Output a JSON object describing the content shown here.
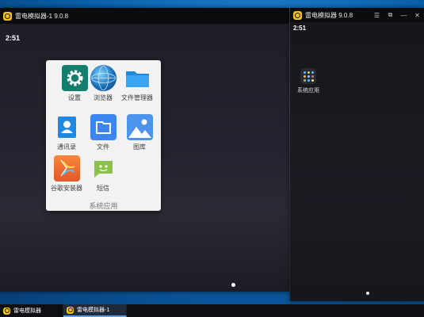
{
  "window_main": {
    "title": "雷电模拟器-1 9.0.8",
    "clock": "2:51",
    "folder": {
      "label": "系统应用",
      "apps": [
        {
          "label": "设置",
          "icon": "settings-icon"
        },
        {
          "label": "浏览器",
          "icon": "browser-globe-icon"
        },
        {
          "label": "文件管理器",
          "icon": "file-manager-folder-icon"
        },
        {
          "label": "通讯录",
          "icon": "contacts-icon"
        },
        {
          "label": "文件",
          "icon": "files-icon"
        },
        {
          "label": "图库",
          "icon": "gallery-icon"
        },
        {
          "label": "谷歌安装器",
          "icon": "google-installer-icon"
        },
        {
          "label": "短信",
          "icon": "sms-icon"
        }
      ]
    }
  },
  "window_second": {
    "title": "雷电模拟器 9.0.8",
    "clock": "2:51",
    "desktop_app_label": "系统应用"
  },
  "taskbar": {
    "items": [
      {
        "label": "雷电模拟器"
      },
      {
        "label": "雷电模拟器-1"
      }
    ]
  },
  "colors": {
    "accent": "#f3c21b",
    "settings": "#127e6c",
    "files": "#3d86f0",
    "gallery": "#4c94ec",
    "installer": "#f06a2b",
    "sms": "#8bc34a"
  }
}
